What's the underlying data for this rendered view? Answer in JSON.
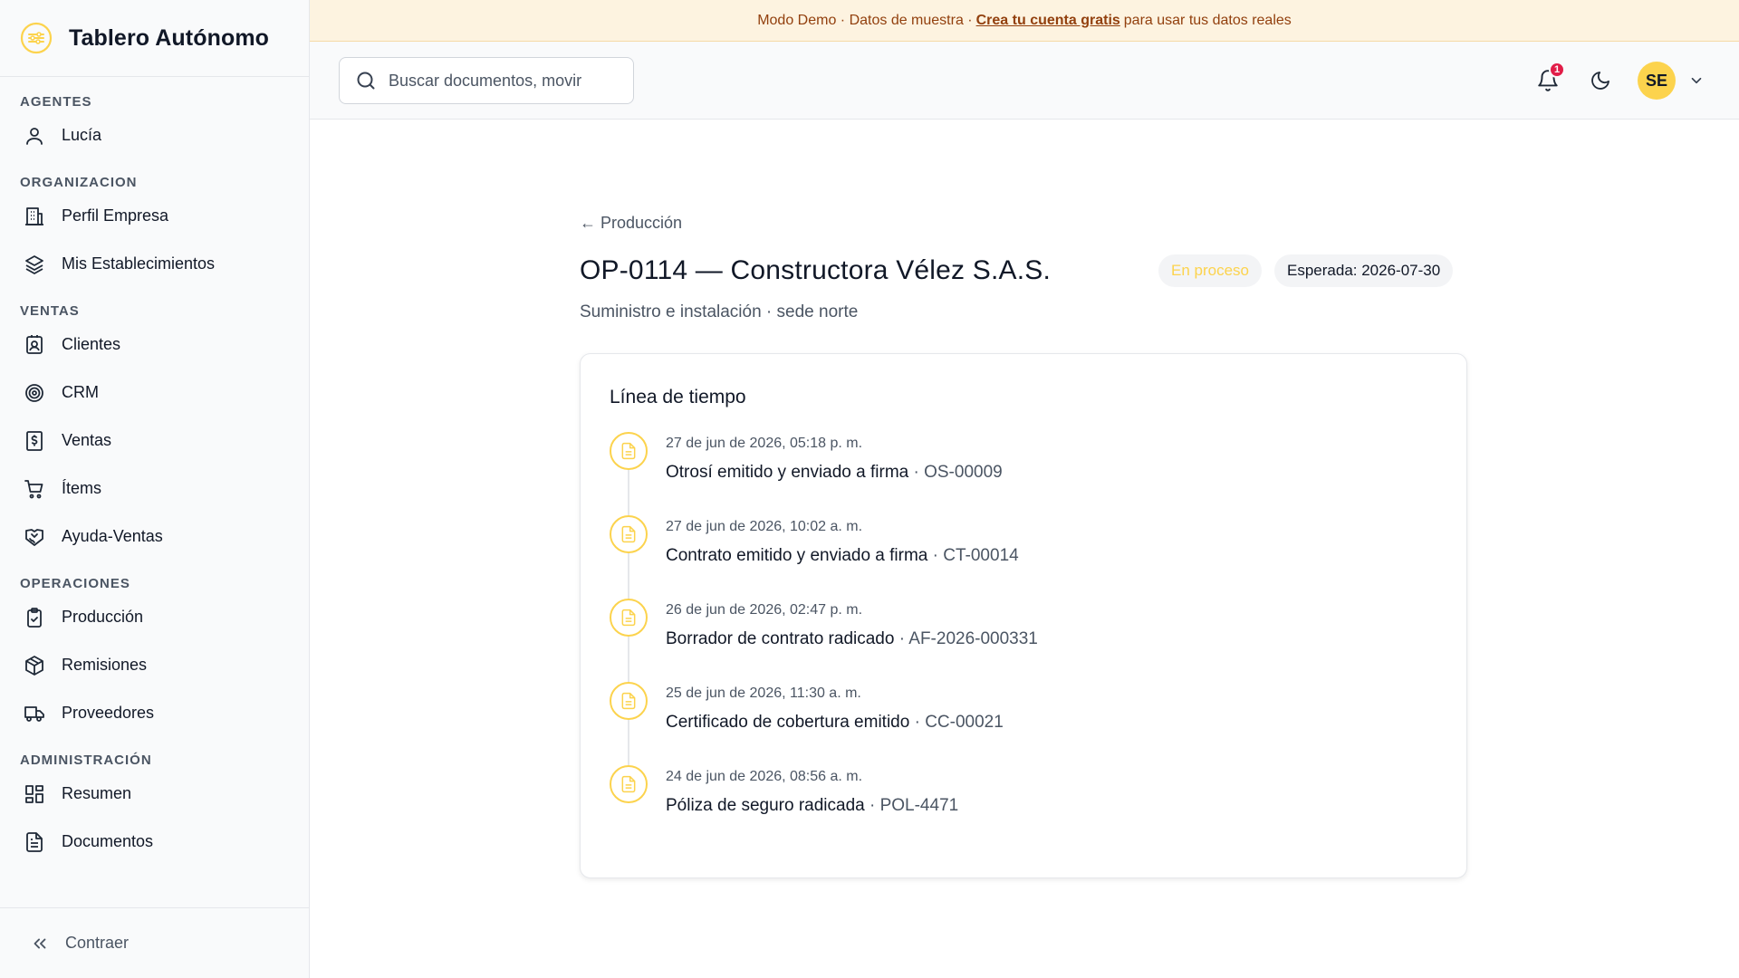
{
  "app": {
    "title": "Tablero Autónomo"
  },
  "sidebar": {
    "sections": [
      {
        "label": "AGENTES",
        "items": [
          {
            "label": "Lucía",
            "icon": "user-icon"
          }
        ]
      },
      {
        "label": "ORGANIZACION",
        "items": [
          {
            "label": "Perfil Empresa",
            "icon": "building-icon"
          },
          {
            "label": "Mis Establecimientos",
            "icon": "layers-icon"
          }
        ]
      },
      {
        "label": "VENTAS",
        "items": [
          {
            "label": "Clientes",
            "icon": "contact-icon"
          },
          {
            "label": "CRM",
            "icon": "target-icon"
          },
          {
            "label": "Ventas",
            "icon": "receipt-icon"
          },
          {
            "label": "Ítems",
            "icon": "cart-icon"
          },
          {
            "label": "Ayuda-Ventas",
            "icon": "handshake-icon"
          }
        ]
      },
      {
        "label": "OPERACIONES",
        "items": [
          {
            "label": "Producción",
            "icon": "clipboard-check-icon"
          },
          {
            "label": "Remisiones",
            "icon": "package-icon"
          },
          {
            "label": "Proveedores",
            "icon": "truck-icon"
          }
        ]
      },
      {
        "label": "ADMINISTRACIÓN",
        "items": [
          {
            "label": "Resumen",
            "icon": "dashboard-icon"
          },
          {
            "label": "Documentos",
            "icon": "document-icon"
          }
        ]
      }
    ],
    "collapse_label": "Contraer"
  },
  "banner": {
    "prefix": "Modo Demo · Datos de muestra ·",
    "link": "Crea tu cuenta gratis",
    "suffix": "para usar tus datos reales"
  },
  "topbar": {
    "search_placeholder": "Buscar documentos, movir",
    "notifications_count": "1",
    "avatar_initials": "SE"
  },
  "page": {
    "back_label": "← Producción",
    "title": "OP-0114 — Constructora Vélez S.A.S.",
    "subtitle": "Suministro e instalación · sede norte",
    "status": "En proceso",
    "expected": "Esperada: 2026-07-30"
  },
  "timeline": {
    "title": "Línea de tiempo",
    "events": [
      {
        "date": "27 de jun de 2026, 05:18 p. m.",
        "text": "Otrosí emitido y enviado a firma",
        "ref": "· OS-00009"
      },
      {
        "date": "27 de jun de 2026, 10:02 a. m.",
        "text": "Contrato emitido y enviado a firma",
        "ref": "· CT-00014"
      },
      {
        "date": "26 de jun de 2026, 02:47 p. m.",
        "text": "Borrador de contrato radicado",
        "ref": "· AF-2026-000331"
      },
      {
        "date": "25 de jun de 2026, 11:30 a. m.",
        "text": "Certificado de cobertura emitido",
        "ref": "· CC-00021"
      },
      {
        "date": "24 de jun de 2026, 08:56 a. m.",
        "text": "Póliza de seguro radicada",
        "ref": "· POL-4471"
      }
    ]
  },
  "colors": {
    "accent": "#fcd34d",
    "banner_bg": "#fdf3e0",
    "banner_text": "#92400e",
    "badge_red": "#e11d48"
  }
}
